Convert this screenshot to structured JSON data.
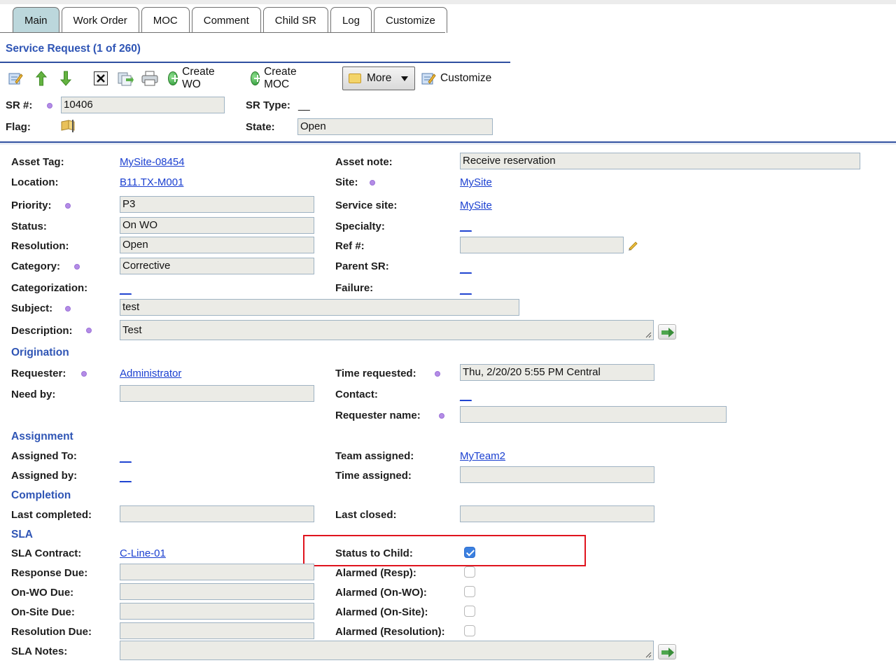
{
  "tabs": [
    {
      "label": "Main"
    },
    {
      "label": "Work Order"
    },
    {
      "label": "MOC"
    },
    {
      "label": "Comment"
    },
    {
      "label": "Child SR"
    },
    {
      "label": "Log"
    },
    {
      "label": "Customize"
    }
  ],
  "header": {
    "title": "Service Request (1 of 260)"
  },
  "toolbar": {
    "create_wo": "Create WO",
    "create_moc": "Create MOC",
    "more": "More",
    "customize": "Customize"
  },
  "top": {
    "sr_label": "SR #:",
    "sr_value": "10406",
    "sr_type_label": "SR Type:",
    "sr_type_value": "__",
    "flag_label": "Flag:",
    "state_label": "State:",
    "state_value": "Open"
  },
  "form": {
    "asset_tag": {
      "label": "Asset Tag:",
      "value": "MySite-08454"
    },
    "asset_note": {
      "label": "Asset note:",
      "value": "Receive reservation"
    },
    "location": {
      "label": "Location:",
      "value": "B11.TX-M001"
    },
    "site": {
      "label": "Site:",
      "value": "MySite"
    },
    "priority": {
      "label": "Priority:",
      "value": "P3"
    },
    "service_site": {
      "label": "Service site:",
      "value": "MySite"
    },
    "status": {
      "label": "Status:",
      "value": "On WO"
    },
    "specialty": {
      "label": "Specialty:",
      "value": "__"
    },
    "resolution": {
      "label": "Resolution:",
      "value": "Open"
    },
    "ref": {
      "label": "Ref #:",
      "value": ""
    },
    "category": {
      "label": "Category:",
      "value": "Corrective"
    },
    "parent_sr": {
      "label": "Parent SR:",
      "value": "__"
    },
    "categorization": {
      "label": "Categorization:",
      "value": "__"
    },
    "failure": {
      "label": "Failure:",
      "value": "__"
    },
    "subject": {
      "label": "Subject:",
      "value": "test"
    },
    "description": {
      "label": "Description:",
      "value": "Test"
    }
  },
  "origination": {
    "title": "Origination",
    "requester": {
      "label": "Requester:",
      "value": "Administrator"
    },
    "time_requested": {
      "label": "Time requested:",
      "value": "Thu, 2/20/20 5:55 PM Central"
    },
    "need_by": {
      "label": "Need by:",
      "value": ""
    },
    "contact": {
      "label": "Contact:",
      "value": "__"
    },
    "requester_name": {
      "label": "Requester name:",
      "value": ""
    }
  },
  "assignment": {
    "title": "Assignment",
    "assigned_to": {
      "label": "Assigned To:",
      "value": "__"
    },
    "team_assigned": {
      "label": "Team assigned:",
      "value": "MyTeam2"
    },
    "assigned_by": {
      "label": "Assigned by:",
      "value": "__"
    },
    "time_assigned": {
      "label": "Time assigned:",
      "value": ""
    }
  },
  "completion": {
    "title": "Completion",
    "last_completed": {
      "label": "Last completed:",
      "value": ""
    },
    "last_closed": {
      "label": "Last closed:",
      "value": ""
    }
  },
  "sla": {
    "title": "SLA",
    "contract": {
      "label": "SLA Contract:",
      "value": "C-Line-01"
    },
    "status_to_child": {
      "label": "Status to Child:",
      "checked": true
    },
    "response_due": {
      "label": "Response Due:",
      "value": ""
    },
    "alarmed_resp": {
      "label": "Alarmed (Resp):",
      "checked": false
    },
    "onwo_due": {
      "label": "On-WO Due:",
      "value": ""
    },
    "alarmed_onwo": {
      "label": "Alarmed (On-WO):",
      "checked": false
    },
    "onsite_due": {
      "label": "On-Site Due:",
      "value": ""
    },
    "alarmed_onsite": {
      "label": "Alarmed (On-Site):",
      "checked": false
    },
    "resolution_due": {
      "label": "Resolution Due:",
      "value": ""
    },
    "alarmed_resolution": {
      "label": "Alarmed (Resolution):",
      "checked": false
    },
    "notes": {
      "label": "SLA Notes:",
      "value": ""
    }
  },
  "colors": {
    "accent": "#2f55b5",
    "link": "#1a3fd0",
    "active_tab": "#bcd7dc",
    "highlight": "#e0141e"
  }
}
